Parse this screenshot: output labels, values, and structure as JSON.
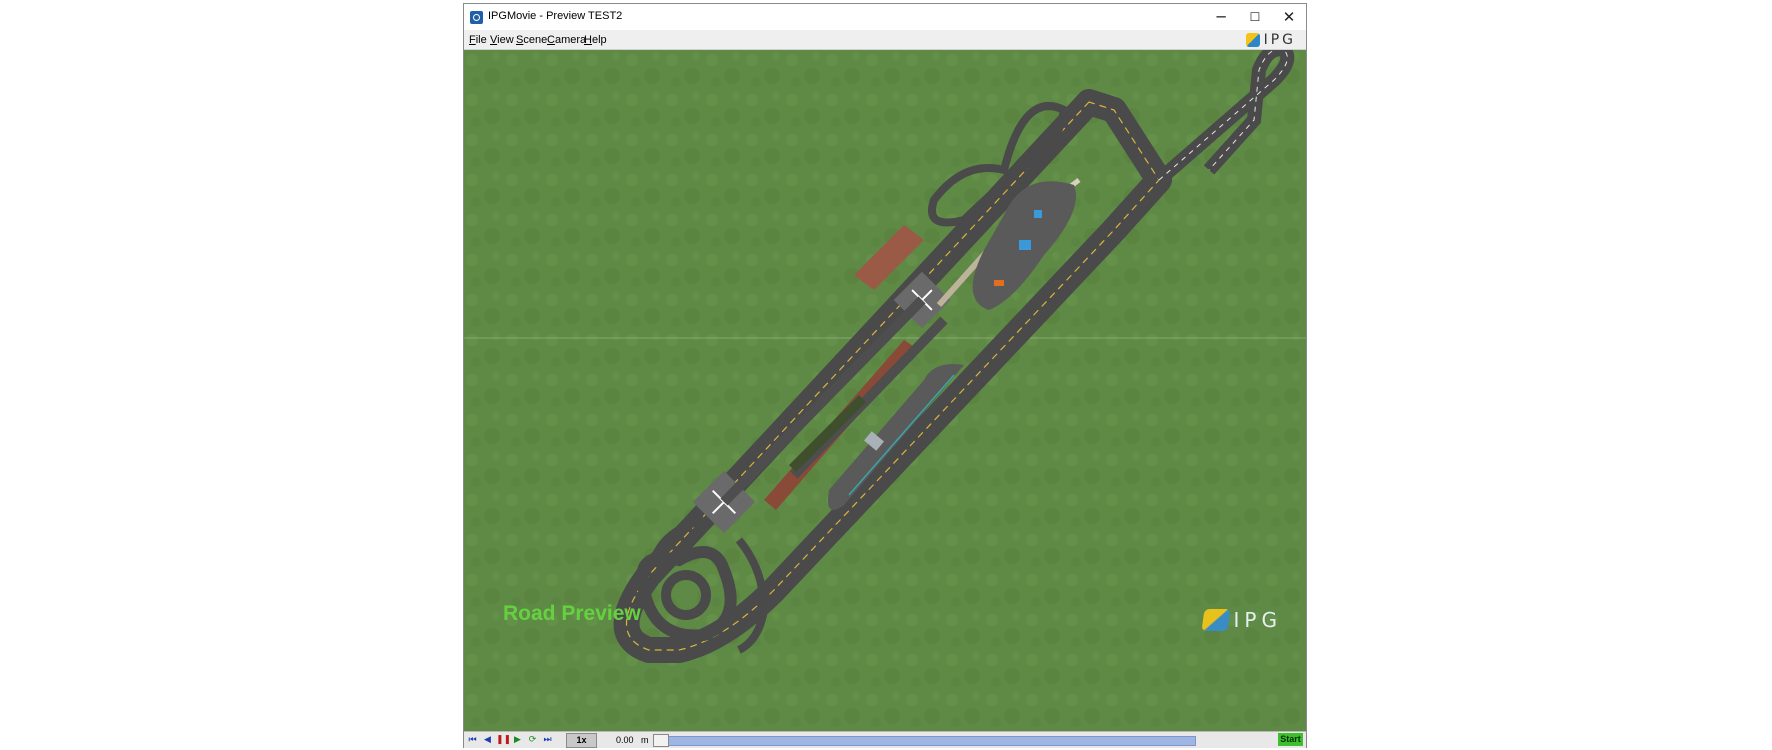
{
  "window": {
    "title": "IPGMovie - Preview TEST2",
    "controls": {
      "minimize": "─",
      "maximize": "☐",
      "close": "✕"
    }
  },
  "menu": {
    "items": [
      "File",
      "View",
      "Scene",
      "Camera",
      "Help"
    ],
    "logo_text": "IPG"
  },
  "viewport": {
    "overlay_label": "Road Preview",
    "watermark_text": "IPG",
    "colors": {
      "grass": "#5f8a45",
      "asphalt": "#4a4a4a",
      "label_green": "#66d140"
    }
  },
  "playbar": {
    "speed": "1x",
    "position_value": "0.00",
    "position_unit": "m",
    "start_label": "Start",
    "progress": 0
  },
  "icons": {
    "to_start": "skip-start-icon",
    "step_back": "step-back-icon",
    "pause": "pause-icon",
    "play": "play-icon",
    "loop": "loop-icon",
    "to_end": "skip-end-icon"
  }
}
